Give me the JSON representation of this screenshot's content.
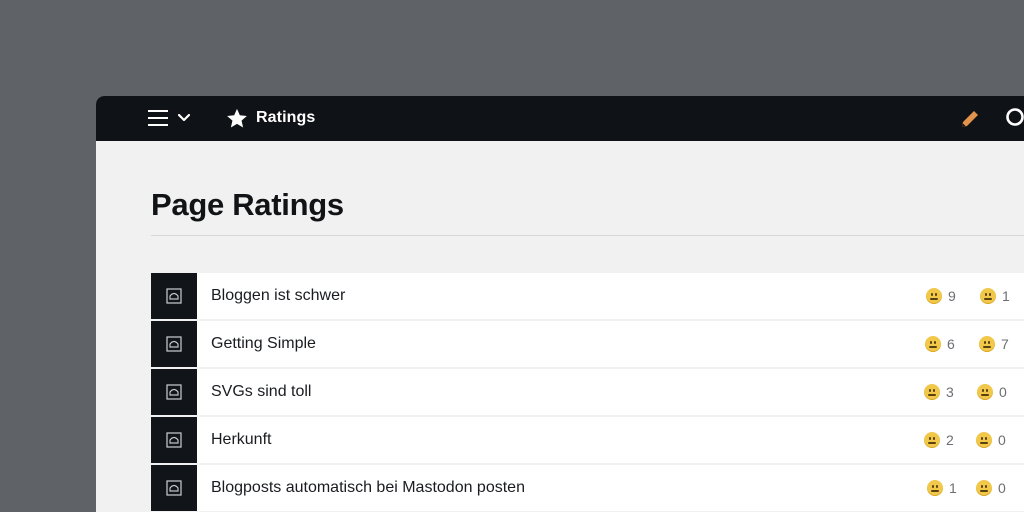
{
  "topbar": {
    "title": "Ratings",
    "menu_icon": "hamburger-menu-icon",
    "dropdown_icon": "chevron-down-icon",
    "section_icon": "star-icon",
    "edit_icon": "pencil-icon",
    "search_icon": "search-icon",
    "edit_color": "#e3934b"
  },
  "page": {
    "title": "Page Ratings"
  },
  "ratings": [
    {
      "label": "Bloggen ist schwer",
      "positive": "9",
      "negative": "1"
    },
    {
      "label": "Getting Simple",
      "positive": "6",
      "negative": "7"
    },
    {
      "label": "SVGs sind toll",
      "positive": "3",
      "negative": "0"
    },
    {
      "label": "Herkunft",
      "positive": "2",
      "negative": "0"
    },
    {
      "label": "Blogposts automatisch bei Mastodon posten",
      "positive": "1",
      "negative": "0"
    }
  ],
  "row_icon": "page-icon",
  "rating_icon": "emoji-face-icon"
}
